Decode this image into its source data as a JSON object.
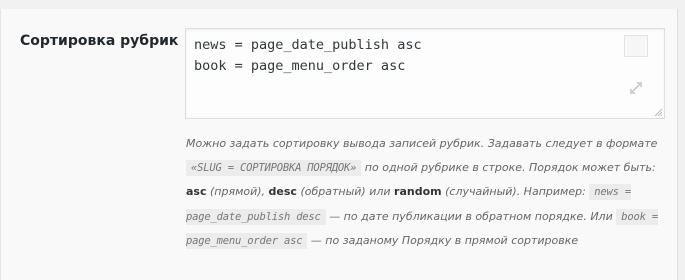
{
  "field": {
    "label": "Сортировка рубрик"
  },
  "textarea": {
    "value": "news = page_date_publish asc\nbook = page_menu_order asc"
  },
  "icons": {
    "expand": "expand-icon",
    "resize": "resize-grip-icon"
  },
  "description": {
    "part1": "Можно задать сортировку вывода записей рубрик. Задавать следует в формате ",
    "code_format": "«SLUG = СОРТИРОВКА ПОРЯДОК»",
    "part2": " по одной рубрике в строке. Порядок может быть: ",
    "asc": "asc",
    "asc_text": " (прямой), ",
    "desc": "desc",
    "desc_text": " (обратный) или ",
    "random": "random",
    "random_text": " (случайный). Например: ",
    "example1": "news = page_date_publish desc",
    "example1_text": " — по дате публикации в обратном порядке. Или ",
    "example2": "book = page_menu_order asc",
    "example2_text": " — по заданому Порядку в прямой сортировке"
  }
}
